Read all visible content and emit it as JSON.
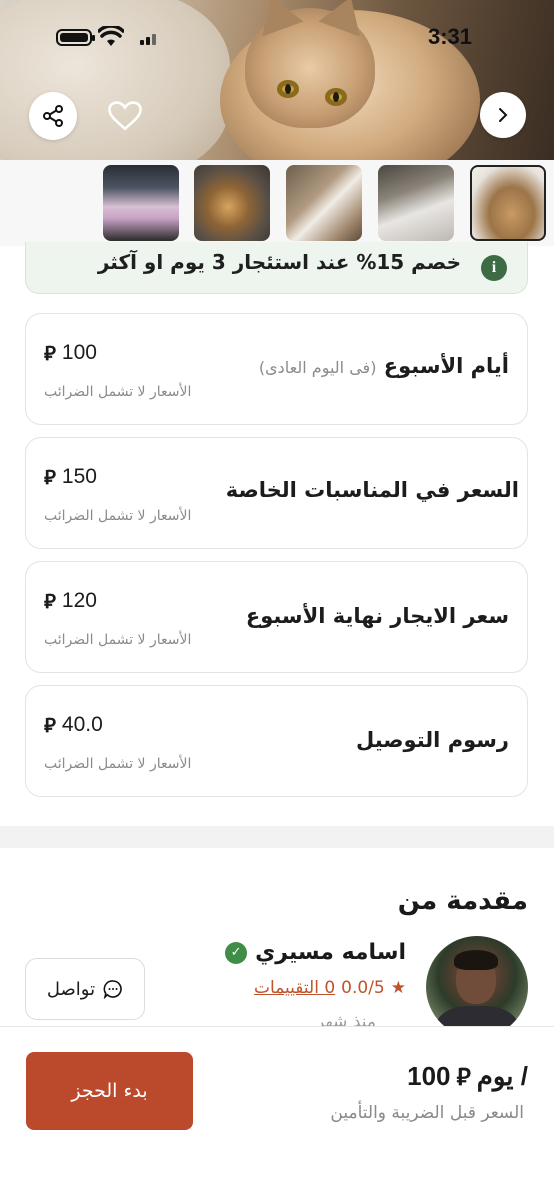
{
  "status_bar": {
    "time": "3:31"
  },
  "hero": {
    "share_icon": "share-icon",
    "favorite_icon": "heart-icon",
    "next_icon": "chevron-right-icon"
  },
  "discount": {
    "text": "خصم 15% عند استئجار 3 يوم  او آكثر",
    "icon": "info-icon"
  },
  "prices": [
    {
      "label": "أيام الأسبوع",
      "sublabel": "(فى اليوم العادى)",
      "amount": "100",
      "note": "الأسعار لا تشمل الضرائب"
    },
    {
      "label": "السعر في المناسبات الخاصة",
      "sublabel": "",
      "amount": "150",
      "note": "الأسعار لا تشمل الضرائب"
    },
    {
      "label": "سعر الايجار نهاية الأسبوع",
      "sublabel": "",
      "amount": "120",
      "note": "الأسعار لا تشمل الضرائب"
    },
    {
      "label": "رسوم التوصيل",
      "sublabel": "",
      "amount": "40.0",
      "note": "الأسعار لا تشمل الضرائب"
    }
  ],
  "currency_symbol": "⃁",
  "host": {
    "title": "مقدمة من",
    "name": "اسامه مسيري",
    "rating": "0.0/5",
    "reviews": "0 التقييمات",
    "since": "منذ شهر",
    "contact_label": "تواصل"
  },
  "bottom_bar": {
    "price": "100",
    "per": "/ يوم",
    "note": "السعر قبل الضريبة والتأمين",
    "book_label": "بدء الحجز"
  },
  "colors": {
    "accent": "#bb4a2c",
    "verified": "#3e8e47",
    "discount_bg": "#eef4ee"
  }
}
